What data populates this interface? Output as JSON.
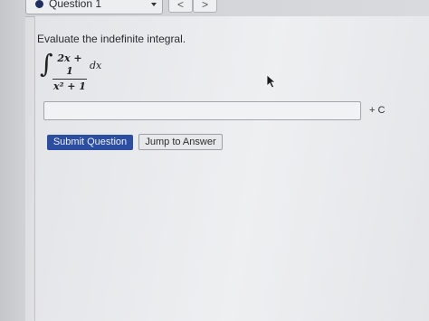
{
  "header": {
    "question_select_label": "Question 1",
    "prev_label": "<",
    "next_label": ">"
  },
  "question": {
    "prompt": "Evaluate the indefinite integral.",
    "integral_sign": "∫",
    "numerator": "2x + 1",
    "denominator": "x² + 1",
    "differential": "dx",
    "answer_value": "",
    "constant_label": "+ C"
  },
  "actions": {
    "submit_label": "Submit Question",
    "jump_label": "Jump to Answer"
  },
  "colors": {
    "accent": "#2c4ea1",
    "status_dot": "#1f2e63"
  },
  "icons": {
    "status": "filled-circle-icon",
    "dropdown": "caret-down-icon",
    "pointer": "mouse-cursor-icon"
  }
}
